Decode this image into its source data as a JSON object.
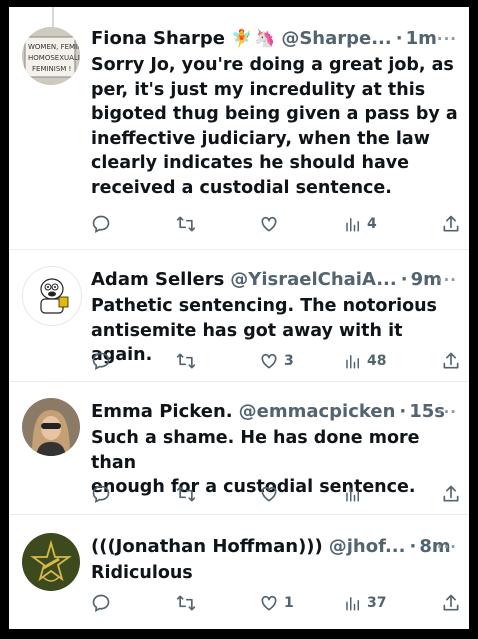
{
  "tweets": [
    {
      "name": "Fiona Sharpe",
      "emoji1": "🧚",
      "emoji2": "🦄",
      "handle": "@Sharpe...",
      "dot": "·",
      "time": "1m",
      "lines": [
        "Sorry Jo, you're doing a great job, as",
        "per, it's just my incredulity at this",
        "bigoted thug being given a pass by a",
        "ineffective judiciary, when the law",
        "clearly indicates he should have",
        "received a custodial sentence."
      ],
      "likes": "",
      "views": "4",
      "avatar": {
        "sign_line1": "WOMEN, FEMINISM",
        "sign_line2": "HOMOSEXUALITY",
        "sign_line3": "FEMINISM !"
      }
    },
    {
      "name": "Adam Sellers",
      "handle": "@YisraelChaiA...",
      "dot": "·",
      "time": "9m",
      "lines": [
        "Pathetic sentencing. The notorious",
        "antisemite has got away with it again."
      ],
      "likes": "3",
      "views": "48"
    },
    {
      "name": "Emma Picken.",
      "handle": "@emmacpicken",
      "dot": "·",
      "time": "15s",
      "lines": [
        "Such a shame. He has done more than",
        "enough for a custodial sentence."
      ],
      "likes": "",
      "views": ""
    },
    {
      "name": "(((Jonathan Hoffman)))",
      "handle": "@jhof...",
      "dot": "·",
      "time": "8m",
      "lines": [
        "Ridiculous"
      ],
      "likes": "1",
      "views": "37"
    }
  ],
  "more_glyph": "···",
  "colors": {
    "text": "#0f1419",
    "secondary": "#536471",
    "divider": "#e6ecf0"
  },
  "icons": [
    "reply-icon",
    "retweet-icon",
    "like-icon",
    "views-icon",
    "share-icon"
  ]
}
